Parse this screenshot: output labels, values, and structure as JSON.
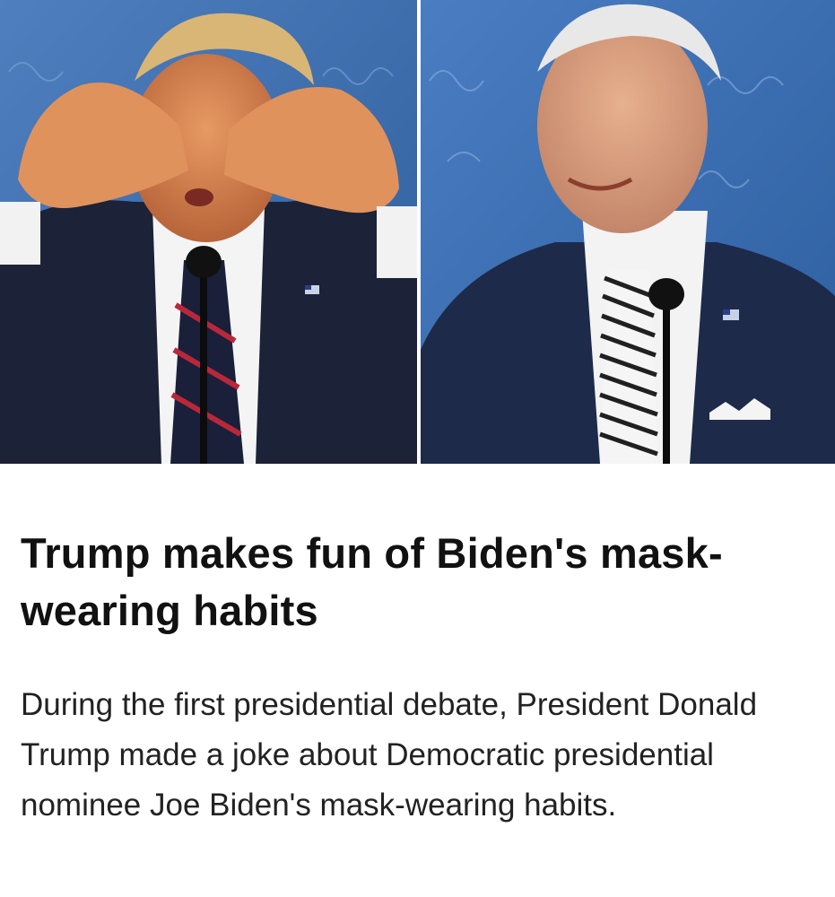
{
  "article": {
    "headline": "Trump makes fun of Biden's mask-wearing habits",
    "summary": "During the first presidential debate, President Donald Trump made a joke about Democratic presidential nominee Joe Biden's mask-wearing habits."
  },
  "hero": {
    "left_photo_icon": "photo-trump-covering-face-icon",
    "right_photo_icon": "photo-biden-smiling-icon",
    "backdrop_color": "#3a6aa8"
  }
}
